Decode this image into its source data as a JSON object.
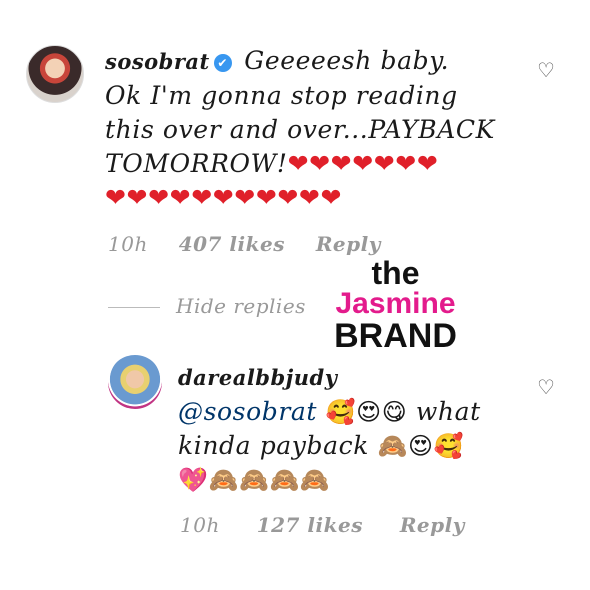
{
  "comment1": {
    "username": "sosobrat",
    "verified_icon": "✔",
    "text_lines": [
      "Geeeeesh baby.",
      "Ok I'm gonna stop reading",
      "this over and over...PAYBACK",
      "TOMORROW!"
    ],
    "hearts_line1": "❤❤❤❤❤❤❤",
    "hearts_line2": "❤❤❤❤❤❤❤❤❤❤❤",
    "time": "10h",
    "likes": "407 likes",
    "reply": "Reply"
  },
  "hide_replies": "Hide replies",
  "comment2": {
    "username": "darealbbjudy",
    "mention": "@sosobrat",
    "emoji1": "🥰😍😋",
    "text1": "what",
    "text2": "kinda payback",
    "emoji2": "🙈😍🥰",
    "emoji3": "💖🙈🙈🙈🙈",
    "time": "10h",
    "likes": "127 likes",
    "reply": "Reply"
  },
  "like_icon": "♡",
  "watermark": {
    "the": "the",
    "jasmine": "Jasmine",
    "brand": "BRAND"
  },
  "colors": {
    "heart": "#e0202a",
    "verified": "#3897f0",
    "mention": "#003569",
    "watermark_pink": "#e31b8c"
  }
}
